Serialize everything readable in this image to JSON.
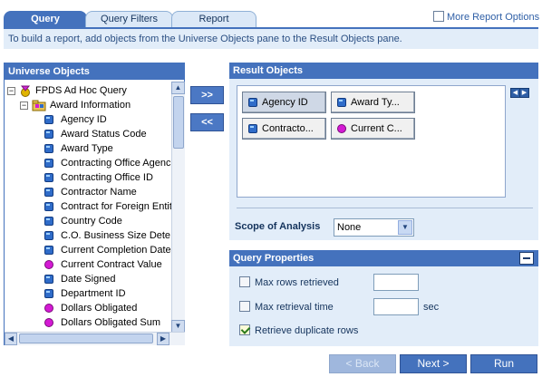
{
  "tabs": [
    {
      "label": "Query",
      "active": true
    },
    {
      "label": "Query Filters",
      "active": false
    },
    {
      "label": "Report",
      "active": false
    }
  ],
  "more_report_options": {
    "label": "More Report Options",
    "checked": false
  },
  "instruction": "To build a report, add objects from the Universe Objects pane to the Result Objects pane.",
  "universe_objects": {
    "title": "Universe Objects",
    "root": {
      "label": "FPDS Ad Hoc Query",
      "expanded": true
    },
    "folder": {
      "label": "Award Information",
      "expanded": true
    },
    "items": [
      {
        "label": "Agency ID",
        "kind": "dimension"
      },
      {
        "label": "Award Status Code",
        "kind": "dimension"
      },
      {
        "label": "Award Type",
        "kind": "dimension"
      },
      {
        "label": "Contracting Office Agenc",
        "kind": "dimension"
      },
      {
        "label": "Contracting Office ID",
        "kind": "dimension"
      },
      {
        "label": "Contractor Name",
        "kind": "dimension"
      },
      {
        "label": "Contract for Foreign Entit",
        "kind": "dimension"
      },
      {
        "label": "Country Code",
        "kind": "dimension"
      },
      {
        "label": "C.O. Business Size Dete",
        "kind": "dimension"
      },
      {
        "label": "Current Completion Date",
        "kind": "dimension"
      },
      {
        "label": "Current Contract Value",
        "kind": "measure"
      },
      {
        "label": "Date Signed",
        "kind": "dimension"
      },
      {
        "label": "Department ID",
        "kind": "dimension"
      },
      {
        "label": "Dollars Obligated",
        "kind": "measure"
      },
      {
        "label": "Dollars Obligated Sum",
        "kind": "measure"
      }
    ]
  },
  "move_buttons": {
    "add": ">>",
    "remove": "<<"
  },
  "result_objects": {
    "title": "Result Objects",
    "chips": [
      {
        "label": "Agency ID",
        "kind": "dimension",
        "selected": true
      },
      {
        "label": "Award Ty...",
        "kind": "dimension",
        "selected": false
      },
      {
        "label": "Contracto...",
        "kind": "dimension",
        "selected": false
      },
      {
        "label": "Current C...",
        "kind": "measure",
        "selected": false
      }
    ],
    "scope_label": "Scope of Analysis",
    "scope_value": "None"
  },
  "query_properties": {
    "title": "Query Properties",
    "max_rows": {
      "label": "Max rows retrieved",
      "checked": false,
      "value": ""
    },
    "max_time": {
      "label": "Max retrieval time",
      "checked": false,
      "value": "",
      "unit": "sec"
    },
    "duplicates": {
      "label": "Retrieve duplicate rows",
      "checked": true
    }
  },
  "wizard": {
    "back": "< Back",
    "next": "Next >",
    "run": "Run"
  },
  "colors": {
    "accent": "#4472bd",
    "panel_bg": "#e2edf9",
    "dimension": "#2f6cc9",
    "measure": "#d41ad4"
  },
  "icons": {
    "root": "universe-icon",
    "folder": "class-folder-icon",
    "dimension": "dimension-icon",
    "measure": "measure-icon"
  }
}
